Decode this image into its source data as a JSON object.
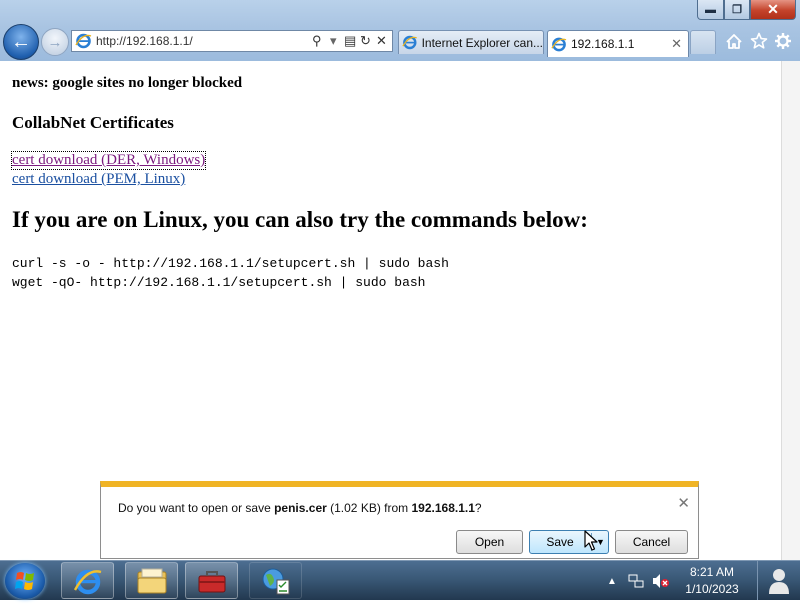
{
  "window": {
    "address": "http://192.168.1.1/",
    "tabs": [
      {
        "label": "Internet Explorer can..."
      },
      {
        "label": "192.168.1.1"
      }
    ],
    "controls": {
      "minimize": "▬",
      "maximize": "❐",
      "close": "✕"
    }
  },
  "page": {
    "news": "news: google sites no longer blocked",
    "certs_heading": "CollabNet Certificates",
    "links": [
      {
        "label": "cert download (DER, Windows)"
      },
      {
        "label": "cert download (PEM, Linux)"
      }
    ],
    "linux_heading": "If you are on Linux, you can also try the commands below:",
    "commands": [
      "curl -s -o - http://192.168.1.1/setupcert.sh | sudo bash",
      "wget -qO- http://192.168.1.1/setupcert.sh | sudo bash"
    ]
  },
  "download_bar": {
    "prefix": "Do you want to open or save ",
    "filename": "penis.cer",
    "size": " (1.02 KB) from ",
    "host": "192.168.1.1",
    "suffix": "?",
    "open_label": "Open",
    "save_label": "Save",
    "cancel_label": "Cancel",
    "accent_color": "#f0b425"
  },
  "taskbar": {
    "items": [
      "internet-explorer",
      "windows-explorer",
      "toolbox",
      "network-app"
    ],
    "time": "8:21 AM",
    "date": "1/10/2023"
  },
  "icons": {
    "back": "back-arrow-icon",
    "forward": "forward-arrow-icon",
    "search": "search-icon",
    "refresh": "refresh-icon",
    "stop": "stop-icon",
    "home": "home-icon",
    "favorites": "star-icon",
    "tools": "gear-icon"
  }
}
